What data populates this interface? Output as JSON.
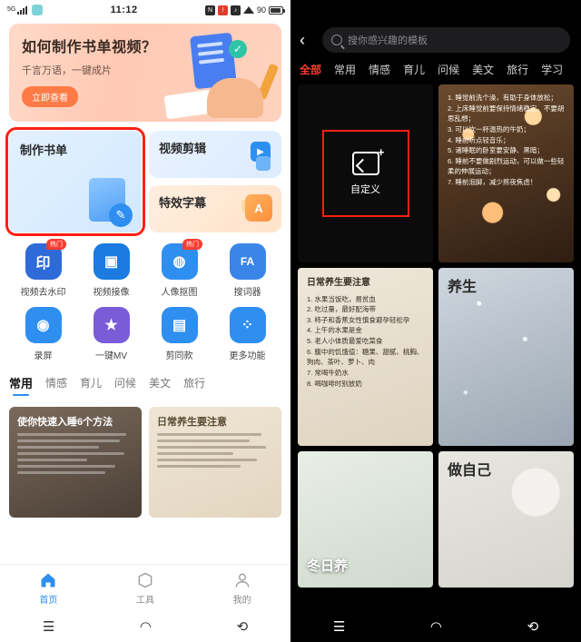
{
  "left": {
    "status_bar": {
      "network": "5G",
      "time": "11:12",
      "battery": "90"
    },
    "banner": {
      "title": "如何制作书单视频？",
      "subtitle": "千言万语，一键成片",
      "button": "立即查看"
    },
    "feature_cards": [
      {
        "title": "制作书单",
        "selected": true
      },
      {
        "title": "视频剪辑",
        "selected": false
      },
      {
        "title": "特效字幕",
        "selected": false
      }
    ],
    "tools": [
      {
        "label": "视频去水印",
        "glyph": "印",
        "color": "#2f6bd8",
        "badge": "热门"
      },
      {
        "label": "视频接像",
        "glyph": "▣",
        "color": "#1b7be0",
        "badge": ""
      },
      {
        "label": "人像抠图",
        "glyph": "人",
        "color": "#2f8ff0",
        "badge": "热门"
      },
      {
        "label": "搜词器",
        "glyph": "FA",
        "color": "#3a86e8",
        "badge": ""
      },
      {
        "label": "录屏",
        "glyph": "◉",
        "color": "#2f8ff0",
        "badge": ""
      },
      {
        "label": "一键MV",
        "glyph": "★",
        "color": "#7a5bd8",
        "badge": ""
      },
      {
        "label": "剪同款",
        "glyph": "▤",
        "color": "#2f8ff0",
        "badge": ""
      },
      {
        "label": "更多功能",
        "glyph": "⁘",
        "color": "#2f8ff0",
        "badge": ""
      }
    ],
    "tabs": [
      {
        "label": "常用",
        "active": true
      },
      {
        "label": "情感",
        "active": false
      },
      {
        "label": "育儿",
        "active": false
      },
      {
        "label": "问候",
        "active": false
      },
      {
        "label": "美文",
        "active": false
      },
      {
        "label": "旅行",
        "active": false
      }
    ],
    "previews": [
      {
        "title": "使你快速入睡6个方法",
        "lines": [
          "1. 睡觉前洗个澡，有助于身体放松。",
          "2. 上床睡觉前要保持情绪稳定，不要胡思乱想；",
          "3. 可以饮一杯温热的牛奶；",
          "4. 睡前听点轻音乐；",
          "5. 诸睡眠的卧室要安静、黑暗；"
        ]
      },
      {
        "title": "日常养生要注意",
        "lines": [
          "1. 水果当饭吃，易贫血",
          "2. 吃过量，最好配海带",
          "3. 柿子和香蕉女性慎食避孕轻松孕",
          "4. 上午的水果是金",
          "5. 老人小体质最爱吃菜食"
        ]
      }
    ],
    "bottom_nav": [
      {
        "label": "首页",
        "icon": "home-icon",
        "active": true
      },
      {
        "label": "工具",
        "icon": "tools-icon",
        "active": false
      },
      {
        "label": "我的",
        "icon": "profile-icon",
        "active": false
      }
    ],
    "system_nav": [
      "menu-icon",
      "home-icon",
      "back-icon"
    ]
  },
  "right": {
    "search_placeholder": "搜你感兴趣的模板",
    "back_icon": "back-arrow-icon",
    "tabs": [
      {
        "label": "全部",
        "active": true
      },
      {
        "label": "常用",
        "active": false
      },
      {
        "label": "情感",
        "active": false
      },
      {
        "label": "育儿",
        "active": false
      },
      {
        "label": "问候",
        "active": false
      },
      {
        "label": "美文",
        "active": false
      },
      {
        "label": "旅行",
        "active": false
      },
      {
        "label": "学习",
        "active": false
      }
    ],
    "custom_card": {
      "label": "自定义",
      "selected": true,
      "icon": "add-image-icon"
    },
    "templates": [
      {
        "title": "",
        "lines": [
          "1. 睡觉前洗个澡，有助于身体放松；",
          "2. 上床睡觉前要保持情绪稳定，不要胡思乱想；",
          "3. 可以饮一杯温热的牛奶；",
          "4. 睡前听点轻音乐；",
          "5. 诸睡眠的卧室要安静、黑暗；",
          "6. 睡前不要做剧烈运动，可以做一些轻柔的伸展运动；",
          "7. 睡前泡脚，减少熬夜焦虑！"
        ],
        "overlay": ""
      },
      {
        "title": "日常养生要注意",
        "lines": [
          "1. 水果当饭吃，易贫血",
          "2. 吃过量，最好配海带",
          "3. 柿子和香蕉女性慎食避孕轻松孕",
          "4. 上午的水果是金",
          "5. 老人小体质最爱吃菜食",
          "6. 腹中的饥饿值：糖果、甜腻、桃胸、狗肉、茶叶、萝卜、肉",
          "7. 常喝牛奶水",
          "8. 喝咖啡时别放奶"
        ],
        "overlay": "养生"
      },
      {
        "title": "",
        "lines": [],
        "overlay": "冬日养"
      },
      {
        "title": "",
        "lines": [],
        "overlay": "做自己"
      }
    ],
    "system_nav": [
      "menu-icon",
      "home-icon",
      "back-icon"
    ]
  }
}
